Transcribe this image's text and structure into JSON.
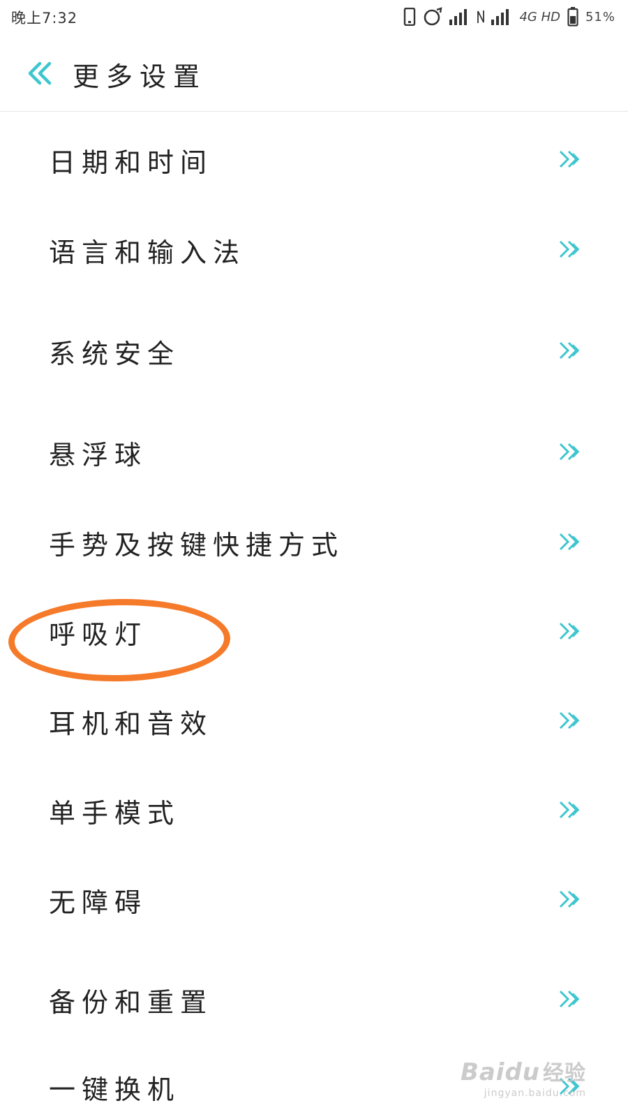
{
  "status_bar": {
    "time": "晚上7:32",
    "network": "4G HD",
    "battery": "51%"
  },
  "header": {
    "title": "更多设置"
  },
  "settings": {
    "items": [
      {
        "label": "日期和时间"
      },
      {
        "label": "语言和输入法"
      },
      {
        "label": "系统安全"
      },
      {
        "label": "悬浮球"
      },
      {
        "label": "手势及按键快捷方式"
      },
      {
        "label": "呼吸灯"
      },
      {
        "label": "耳机和音效"
      },
      {
        "label": "单手模式"
      },
      {
        "label": "无障碍"
      },
      {
        "label": "备份和重置"
      },
      {
        "label": "一键换机"
      }
    ]
  },
  "annotation": {
    "highlighted_item": "呼吸灯",
    "color": "#f57a2a"
  },
  "accent_color": "#3ec6cf",
  "watermark": {
    "brand": "Baidu",
    "brand_cn": "经验",
    "url": "jingyan.baidu.com"
  }
}
